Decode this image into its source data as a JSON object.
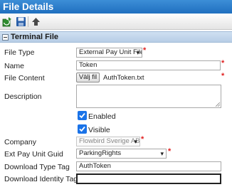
{
  "window": {
    "title": "File Details"
  },
  "toolbar": {
    "buttons": [
      {
        "icon": "refresh-icon"
      },
      {
        "icon": "save-icon"
      },
      {
        "icon": "up-icon"
      }
    ]
  },
  "section": {
    "title": "Terminal File"
  },
  "form": {
    "file_type": {
      "label": "File Type",
      "value": "External Pay Unit File"
    },
    "name": {
      "label": "Name",
      "value": "Token"
    },
    "file_content": {
      "label": "File Content",
      "button": "Välj fil",
      "filename": "AuthToken.txt"
    },
    "description": {
      "label": "Description",
      "value": ""
    },
    "enabled": {
      "label": "Enabled",
      "checked": true
    },
    "visible": {
      "label": "Visible",
      "checked": true
    },
    "company": {
      "label": "Company",
      "value": "Flowbird Sverige AB"
    },
    "ext_pay_unit_guid": {
      "label": "Ext Pay Unit Guid",
      "value": "ParkingRights"
    },
    "download_type_tag": {
      "label": "Download Type Tag",
      "value": "AuthToken"
    },
    "download_identity_tag": {
      "label": "Download Identity Tag",
      "value": ""
    }
  },
  "colors": {
    "title_bar": "#2b7cca",
    "section_header": "#c4d7ec",
    "required": "#e02020",
    "checkbox": "#1a73e8"
  }
}
